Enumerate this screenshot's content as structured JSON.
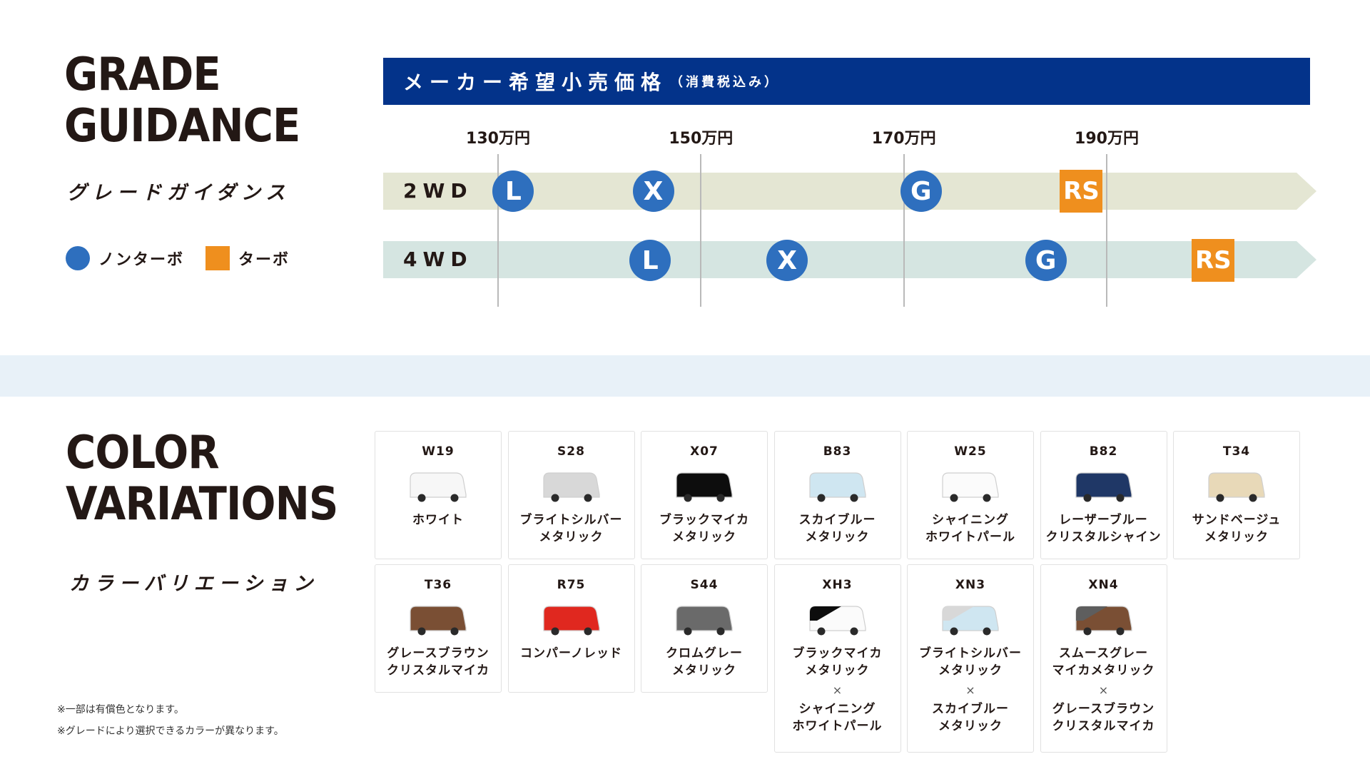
{
  "grade": {
    "title_line1": "GRADE",
    "title_line2": "GUIDANCE",
    "subtitle": "グレードガイダンス",
    "legend_nonturbo": "ノンターボ",
    "legend_turbo": "ターボ",
    "price_header_main": "メーカー希望小売価格",
    "price_header_sub": "（消費税込み）",
    "ticks": [
      "130万円",
      "150万円",
      "170万円",
      "190万円"
    ],
    "rows": [
      {
        "label": "2WD",
        "grades": [
          {
            "name": "L",
            "price": 131.5,
            "type": "nonturbo"
          },
          {
            "name": "X",
            "price": 145.3,
            "type": "nonturbo"
          },
          {
            "name": "G",
            "price": 171.7,
            "type": "nonturbo"
          },
          {
            "name": "RS",
            "price": 187.5,
            "type": "turbo"
          }
        ]
      },
      {
        "label": "4WD",
        "grades": [
          {
            "name": "L",
            "price": 145.0,
            "type": "nonturbo"
          },
          {
            "name": "X",
            "price": 158.5,
            "type": "nonturbo"
          },
          {
            "name": "G",
            "price": 184.0,
            "type": "nonturbo"
          },
          {
            "name": "RS",
            "price": 200.5,
            "type": "turbo"
          }
        ]
      }
    ],
    "colors": {
      "nonturbo": "#2e6fbe",
      "turbo": "#ef8f1e",
      "header": "#03338a"
    }
  },
  "color": {
    "title_line1": "COLOR",
    "title_line2": "VARIATIONS",
    "subtitle": "カラーバリエーション",
    "notes": [
      "※一部は有償色となります。",
      "※グレードにより選択できるカラーが異なります。"
    ],
    "swatches": [
      {
        "code": "W19",
        "name": "ホワイト",
        "color": "#f7f7f7"
      },
      {
        "code": "S28",
        "name": "ブライトシルバー\nメタリック",
        "color": "#d8d8d8"
      },
      {
        "code": "X07",
        "name": "ブラックマイカ\nメタリック",
        "color": "#0d0d0d"
      },
      {
        "code": "B83",
        "name": "スカイブルー\nメタリック",
        "color": "#cfe6f1"
      },
      {
        "code": "W25",
        "name": "シャイニング\nホワイトパール",
        "color": "#fbfbfb"
      },
      {
        "code": "B82",
        "name": "レーザーブルー\nクリスタルシャイン",
        "color": "#1f3766"
      },
      {
        "code": "T34",
        "name": "サンドベージュ\nメタリック",
        "color": "#e8d9b8"
      },
      {
        "code": "T36",
        "name": "グレースブラウン\nクリスタルマイカ",
        "color": "#7a4f34"
      },
      {
        "code": "R75",
        "name": "コンパーノレッド",
        "color": "#e0281f"
      },
      {
        "code": "S44",
        "name": "クロムグレー\nメタリック",
        "color": "#6a6a6a"
      },
      {
        "code": "XH3",
        "name": "ブラックマイカ\nメタリック",
        "times": "×",
        "name2": "シャイニング\nホワイトパール",
        "color": "#fbfbfb",
        "color2": "#0d0d0d"
      },
      {
        "code": "XN3",
        "name": "ブライトシルバー\nメタリック",
        "times": "×",
        "name2": "スカイブルー\nメタリック",
        "color": "#cfe6f1",
        "color2": "#d8d8d8"
      },
      {
        "code": "XN4",
        "name": "スムースグレー\nマイカメタリック",
        "times": "×",
        "name2": "グレースブラウン\nクリスタルマイカ",
        "color": "#7a4f34",
        "color2": "#5e5e5e"
      }
    ]
  }
}
